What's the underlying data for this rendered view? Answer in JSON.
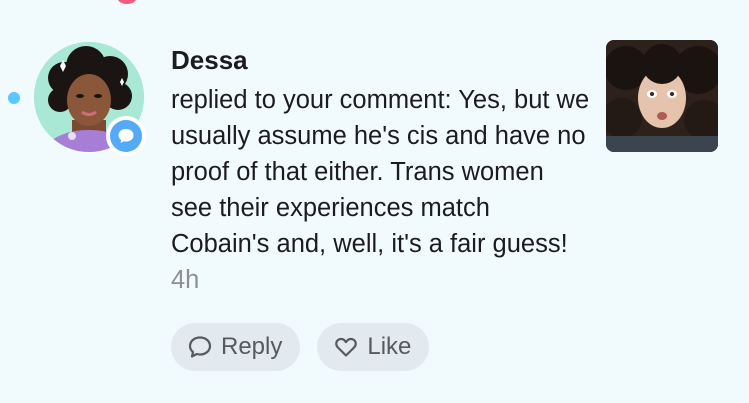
{
  "notification": {
    "username": "Dessa",
    "message": "replied to your comment: Yes, but we usually assume he's cis and have no proof of that either. Trans women see their experiences match Cobain's and, well, it's a fair guess!",
    "timestamp": "4h",
    "unread": true,
    "badge_icon": "speech-bubble-icon"
  },
  "actions": {
    "reply_label": "Reply",
    "like_label": "Like"
  },
  "colors": {
    "background": "#f1fbfe",
    "unread_dot": "#5ac8fa",
    "badge": "#54aaf6",
    "pill_background": "#e2eaef",
    "timestamp": "#8e8e93"
  }
}
